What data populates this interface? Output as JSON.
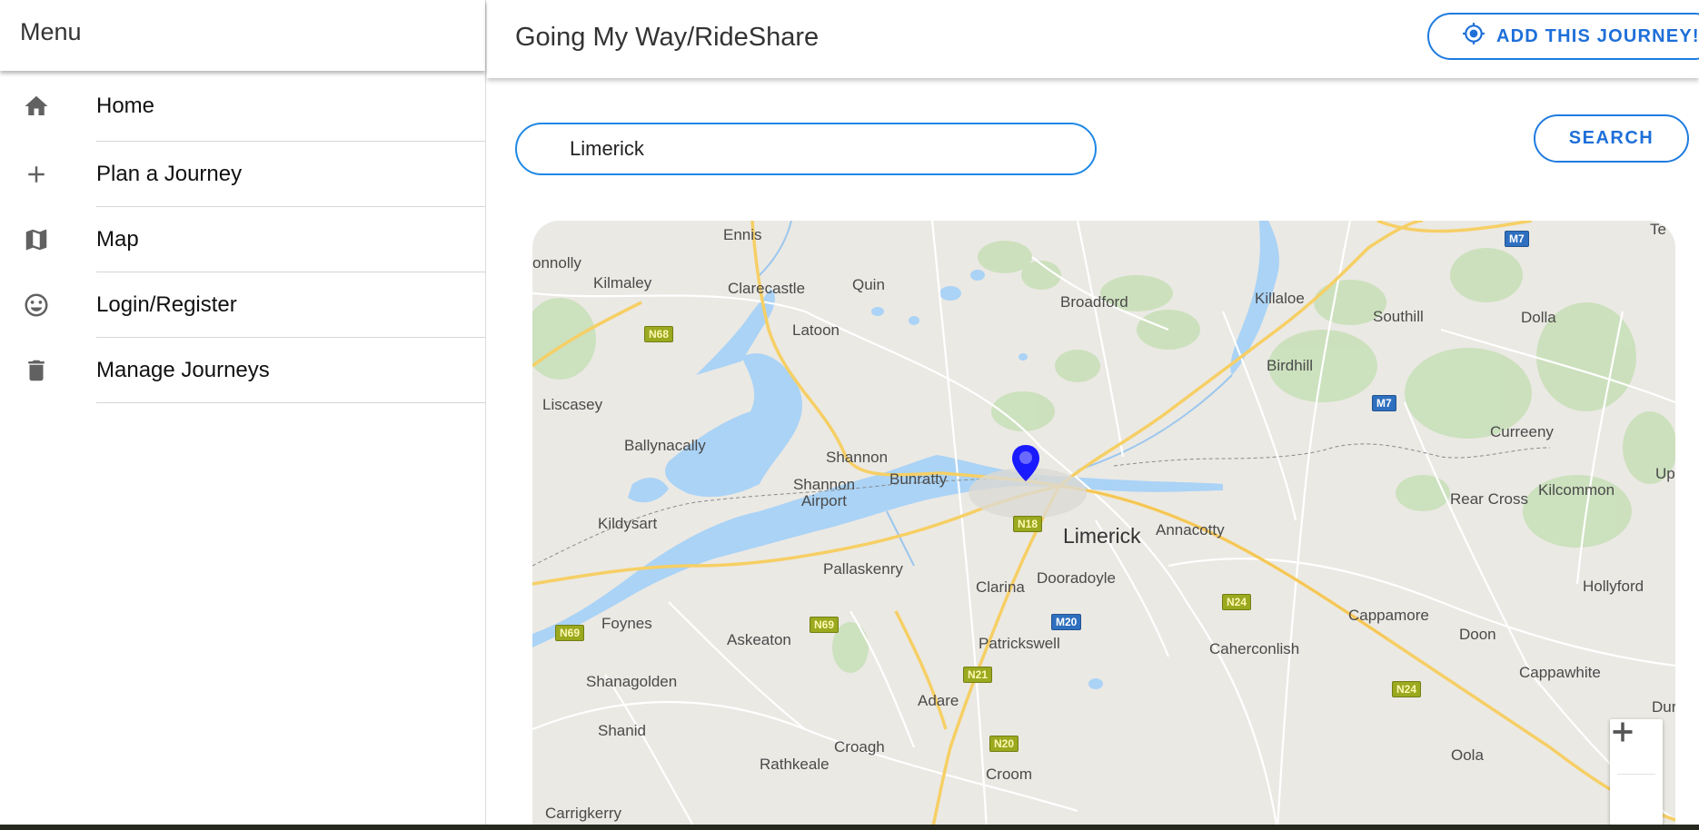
{
  "sidebar": {
    "title": "Menu",
    "items": [
      {
        "label": "Home",
        "icon": "home-icon"
      },
      {
        "label": "Plan a Journey",
        "icon": "plus-icon"
      },
      {
        "label": "Map",
        "icon": "map-icon"
      },
      {
        "label": "Login/Register",
        "icon": "smiley-icon"
      },
      {
        "label": "Manage Journeys",
        "icon": "trash-icon"
      }
    ]
  },
  "header": {
    "title": "Going My Way/RideShare",
    "add_journey_label": "ADD THIS JOURNEY!"
  },
  "search": {
    "value": "Limerick",
    "button_label": "SEARCH"
  },
  "map": {
    "marker_label": "Limerick",
    "places": [
      "Ennis",
      "onnolly",
      "Kilmaley",
      "Clarecastle",
      "Quin",
      "Broadford",
      "Killaloe",
      "Southill",
      "Dolla",
      "Latoon",
      "Birdhill",
      "Liscasey",
      "Ballynacally",
      "Shannon",
      "Shannon Airport",
      "Bunratty",
      "Curreeny",
      "Kildysart",
      "Annacotty",
      "Rear Cross",
      "Kilcommon",
      "Up",
      "Pallaskenry",
      "Clarina",
      "Dooradoyle",
      "Hollyford",
      "Foynes",
      "Askeaton",
      "Patrickswell",
      "Caherconlish",
      "Cappamore",
      "Doon",
      "Shanagolden",
      "Cappawhite",
      "Adare",
      "Shanid",
      "Croagh",
      "Oola",
      "Rathkeale",
      "Croom",
      "Carrigkerry",
      "Dur",
      "Te"
    ],
    "roads": [
      "M7",
      "N68",
      "M7",
      "N18",
      "N24",
      "M20",
      "N69",
      "N69",
      "N21",
      "N24",
      "N20"
    ],
    "zoom_in": "+",
    "zoom_out": "−"
  },
  "colors": {
    "accent": "#1e7be0",
    "water": "#a9d3f5",
    "land": "#e9e7e3",
    "park": "#c8dfb8",
    "road_major": "#f6cf65",
    "marker": "#1a1aff"
  }
}
